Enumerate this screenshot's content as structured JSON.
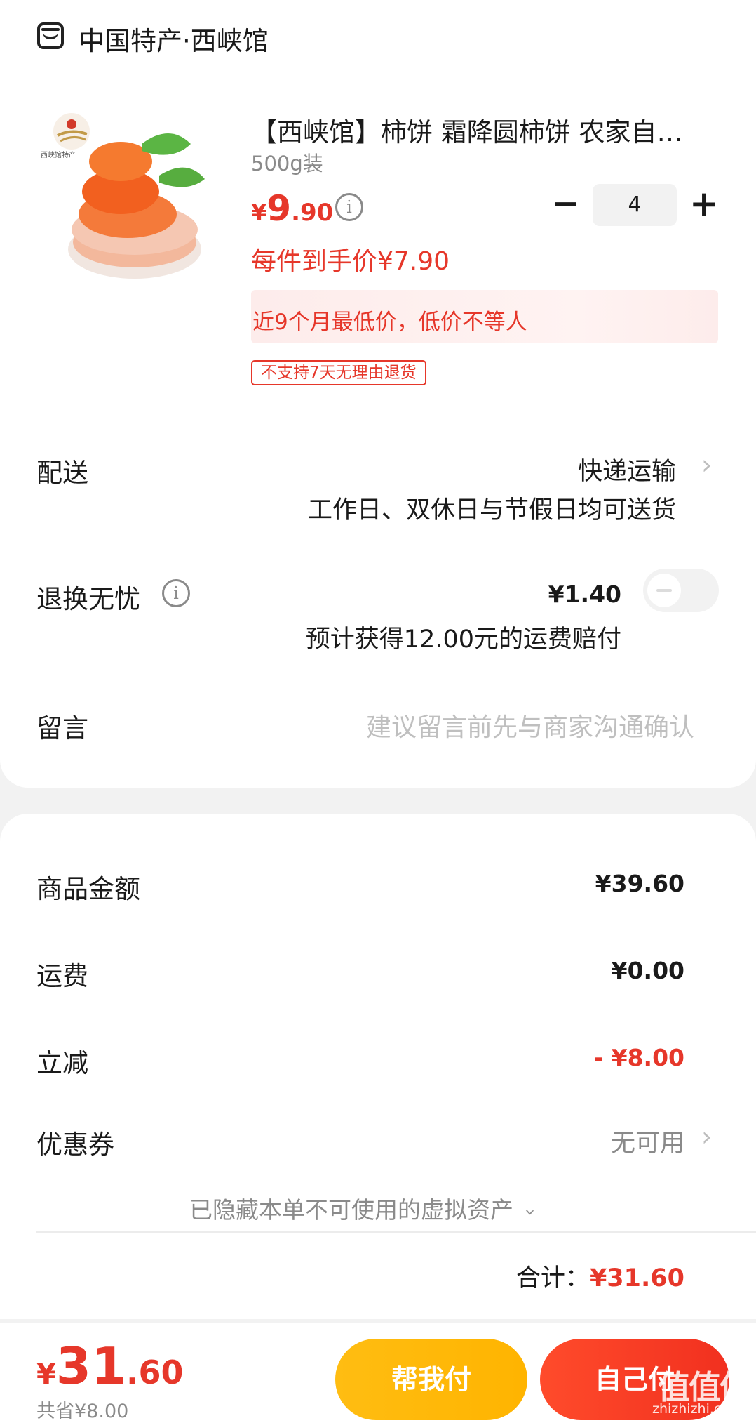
{
  "shop": {
    "icon": "shop-icon",
    "name": "中国特产·西峡馆"
  },
  "product": {
    "title": "【西峡馆】柿饼 霜降圆柿饼 农家自…",
    "spec": "500g装",
    "price_symbol": "¥",
    "price_int": "9",
    "price_dec": ".90",
    "quantity": "4",
    "unit_price": "每件到手价¥7.90",
    "promo": "近9个月最低价，低价不等人",
    "return_tag": "不支持7天无理由退货",
    "image_logo_text": "西峡馆特产"
  },
  "delivery": {
    "label": "配送",
    "value": "快递运输",
    "note": "工作日、双休日与节假日均可送货"
  },
  "returns": {
    "label": "退换无忧",
    "price": "¥1.40",
    "note": "预计获得12.00元的运费赔付",
    "enabled": false
  },
  "message": {
    "label": "留言",
    "placeholder": "建议留言前先与商家沟通确认"
  },
  "summary": {
    "goods_label": "商品金额",
    "goods_value": "¥39.60",
    "shipping_label": "运费",
    "shipping_value": "¥0.00",
    "discount_label": "立减",
    "discount_value": "- ¥8.00",
    "coupon_label": "优惠券",
    "coupon_value": "无可用",
    "hidden_assets": "已隐藏本单不可使用的虚拟资产",
    "total_label": "合计：",
    "total_value": "¥31.60"
  },
  "bottom_bar": {
    "price_symbol": "¥",
    "price_int": "31",
    "price_dec": ".60",
    "saved": "共省¥8.00",
    "help_pay": "帮我付",
    "self_pay": "自己付",
    "watermark": "值值值",
    "watermark_sub": "zhizhizhi.com"
  },
  "colors": {
    "accent": "#e6372a",
    "help_button": "#ffb400",
    "pay_button": "#f1301f"
  }
}
